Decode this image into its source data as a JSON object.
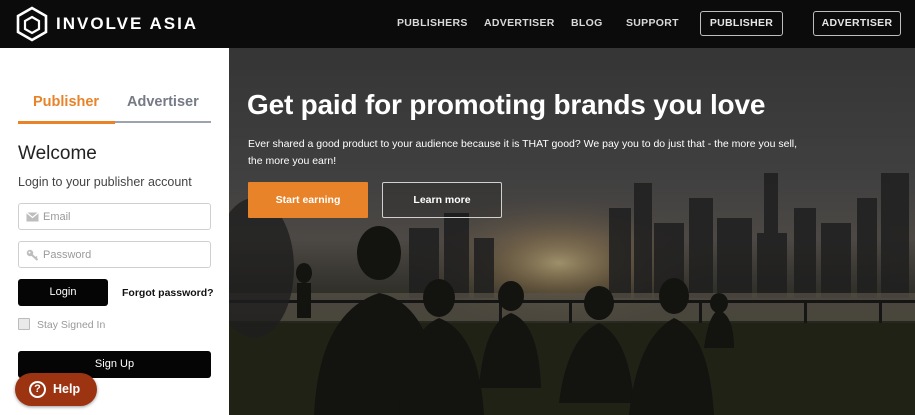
{
  "brand": {
    "name": "INVOLVE ASIA"
  },
  "nav": {
    "links": [
      "PUBLISHERS",
      "ADVERTISER",
      "BLOG",
      "SUPPORT"
    ],
    "buttons": [
      "PUBLISHER",
      "ADVERTISER"
    ]
  },
  "login": {
    "tabs": [
      "Publisher",
      "Advertiser"
    ],
    "active_tab": "Publisher",
    "welcome": "Welcome",
    "subtitle": "Login to your publisher account",
    "email_placeholder": "Email",
    "password_placeholder": "Password",
    "login_label": "Login",
    "forgot_label": "Forgot password?",
    "stay_signed_label": "Stay Signed In",
    "signup_label": "Sign Up"
  },
  "help": {
    "label": "Help"
  },
  "hero": {
    "title": "Get paid for promoting brands you love",
    "text": "Ever shared a good product to your audience because it is THAT good? We pay you to do just that - the more you sell, the more you earn!",
    "start_label": "Start earning",
    "learn_label": "Learn more"
  },
  "colors": {
    "accent": "#e8832a",
    "nav_bg": "#0b0b0b",
    "help_bg": "#9c3412"
  },
  "icons": {
    "logo": "hexagon-cube-logo",
    "email": "envelope-icon",
    "password": "key-icon",
    "help": "question-icon"
  }
}
